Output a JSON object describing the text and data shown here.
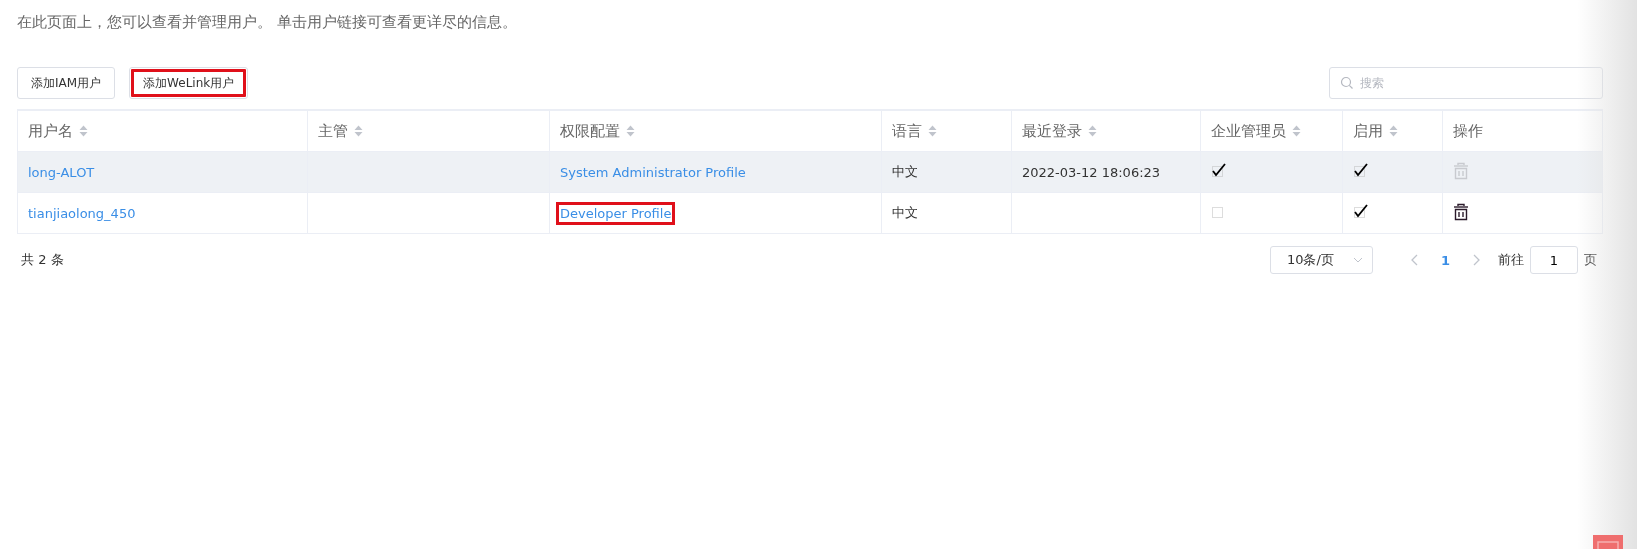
{
  "description": "在此页面上，您可以查看并管理用户。 单击用户链接可查看更详尽的信息。",
  "buttons": [
    {
      "label": "添加IAM用户",
      "highlighted": false
    },
    {
      "label": "添加WeLink用户",
      "highlighted": true
    }
  ],
  "search": {
    "placeholder": "搜索"
  },
  "columns": [
    {
      "label": "用户名",
      "sortable": true
    },
    {
      "label": "主管",
      "sortable": true
    },
    {
      "label": "权限配置",
      "sortable": true
    },
    {
      "label": "语言",
      "sortable": true
    },
    {
      "label": "最近登录",
      "sortable": true
    },
    {
      "label": "企业管理员",
      "sortable": true
    },
    {
      "label": "启用",
      "sortable": true
    },
    {
      "label": "操作",
      "sortable": false
    }
  ],
  "rows": [
    {
      "username": "long-ALOT",
      "profile": "System Administrator Profile",
      "profile_highlighted": false,
      "language": "中文",
      "last_login": "2022-03-12 18:06:23",
      "admin_checked": true,
      "enabled_checked": true,
      "delete_disabled": true,
      "hovered": true
    },
    {
      "username": "tianjiaolong_450",
      "profile": "Developer Profile",
      "profile_highlighted": true,
      "language": "中文",
      "admin_checked": false,
      "enabled_checked": true,
      "delete_disabled": false,
      "hovered": false
    }
  ],
  "pagination": {
    "total": "共 2 条",
    "page_size": "10条/页",
    "pages": [
      {
        "label": "1",
        "selected": true
      }
    ],
    "goto_label": "前往",
    "goto_value": "1",
    "page_unit": "页"
  }
}
